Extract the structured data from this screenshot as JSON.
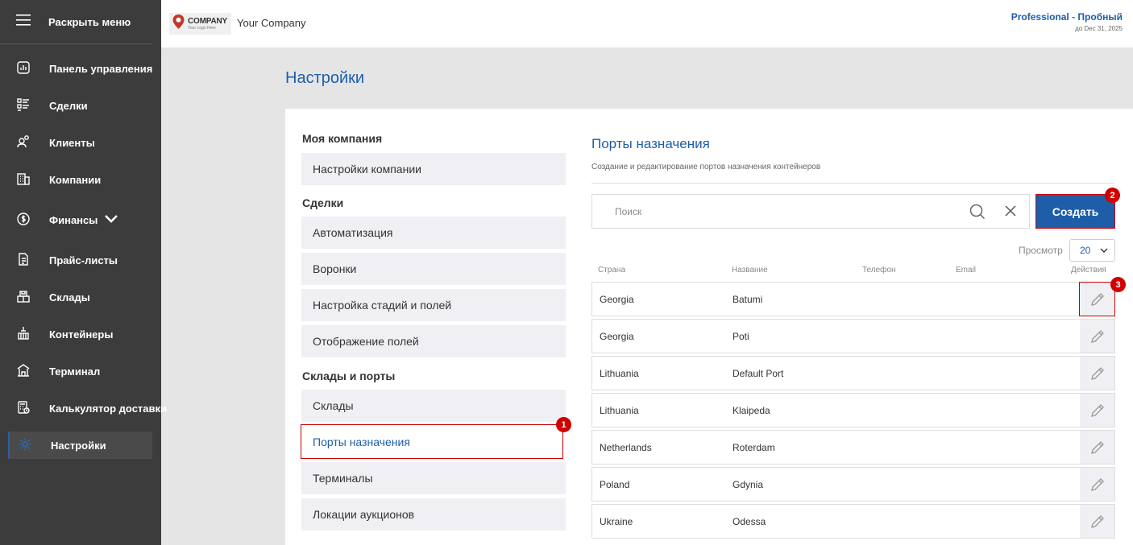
{
  "sidebar": {
    "toggle_label": "Раскрыть меню",
    "items": [
      {
        "label": "Панель управления",
        "icon": "dashboard-icon"
      },
      {
        "label": "Сделки",
        "icon": "deals-icon"
      },
      {
        "label": "Клиенты",
        "icon": "clients-icon"
      },
      {
        "label": "Компании",
        "icon": "companies-icon"
      },
      {
        "label": "Финансы",
        "icon": "finance-icon"
      },
      {
        "label": "Прайс-листы",
        "icon": "price-list-icon"
      },
      {
        "label": "Склады",
        "icon": "warehouse-icon"
      },
      {
        "label": "Контейнеры",
        "icon": "containers-icon"
      },
      {
        "label": "Терминал",
        "icon": "terminal-icon"
      },
      {
        "label": "Калькулятор доставки",
        "icon": "calculator-icon"
      },
      {
        "label": "Настройки",
        "icon": "settings-icon",
        "active": true
      }
    ]
  },
  "header": {
    "logo_main": "COMPANY",
    "logo_sub": "Your Logo Here",
    "company_name": "Your Company",
    "plan_name": "Professional - Пробный",
    "plan_until": "до Dec 31, 2025"
  },
  "page": {
    "title": "Настройки"
  },
  "settings_menu": {
    "sections": [
      {
        "title": "Моя компания",
        "items": [
          "Настройки компании"
        ]
      },
      {
        "title": "Сделки",
        "items": [
          "Автоматизация",
          "Воронки",
          "Настройка стадий и полей",
          "Отображение полей"
        ]
      },
      {
        "title": "Склады и порты",
        "items": [
          "Склады",
          "Порты назначения",
          "Терминалы",
          "Локации аукционов"
        ]
      }
    ],
    "active_item": "Порты назначения"
  },
  "ports": {
    "title": "Порты назначения",
    "subtitle": "Создание и редактирование портов назначения контейнеров",
    "search_placeholder": "Поиск",
    "create_label": "Создать",
    "view_label": "Просмотр",
    "page_size": "20",
    "columns": [
      "Страна",
      "Название",
      "Телефон",
      "Email",
      "Действия"
    ],
    "rows": [
      {
        "country": "Georgia",
        "name": "Batumi"
      },
      {
        "country": "Georgia",
        "name": "Poti"
      },
      {
        "country": "Lithuania",
        "name": "Default Port"
      },
      {
        "country": "Lithuania",
        "name": "Klaipeda"
      },
      {
        "country": "Netherlands",
        "name": "Roterdam"
      },
      {
        "country": "Poland",
        "name": "Gdynia"
      },
      {
        "country": "Ukraine",
        "name": "Odessa"
      }
    ]
  },
  "annotations": [
    "1",
    "2",
    "3"
  ],
  "colors": {
    "sidebar_bg": "#3c3c3c",
    "accent": "#1e5ea8",
    "highlight": "#cc0000",
    "badge": "#d10000"
  }
}
